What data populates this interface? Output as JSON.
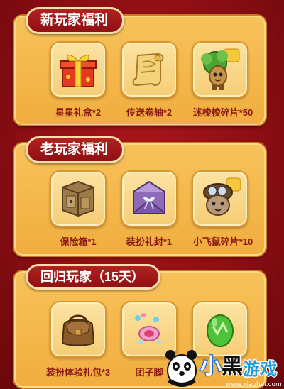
{
  "sections": [
    {
      "title": "新玩家福利",
      "items": [
        {
          "label": "星星礼盒*2",
          "icon": "gift-box-icon"
        },
        {
          "label": "传送卷轴*2",
          "icon": "scroll-icon"
        },
        {
          "label": "迷梭梭碎片*50",
          "icon": "tree-sprite-fragment-icon"
        }
      ]
    },
    {
      "title": "老玩家福利",
      "items": [
        {
          "label": "保险箱*1",
          "icon": "safe-box-icon"
        },
        {
          "label": "装扮礼封*1",
          "icon": "gift-envelope-icon"
        },
        {
          "label": "小飞鼠碎片*10",
          "icon": "pilot-mouse-fragment-icon"
        }
      ]
    },
    {
      "title": "回归玩家（15天）",
      "items": [
        {
          "label": "装扮体验礼包*3",
          "icon": "leather-bag-icon"
        },
        {
          "label": "团子脚",
          "icon": "sparkle-footprint-icon"
        },
        {
          "label": "",
          "icon": "green-egg-icon"
        }
      ]
    }
  ],
  "watermark": {
    "text": "小黑游戏",
    "url": "www.xiaohei.com"
  }
}
